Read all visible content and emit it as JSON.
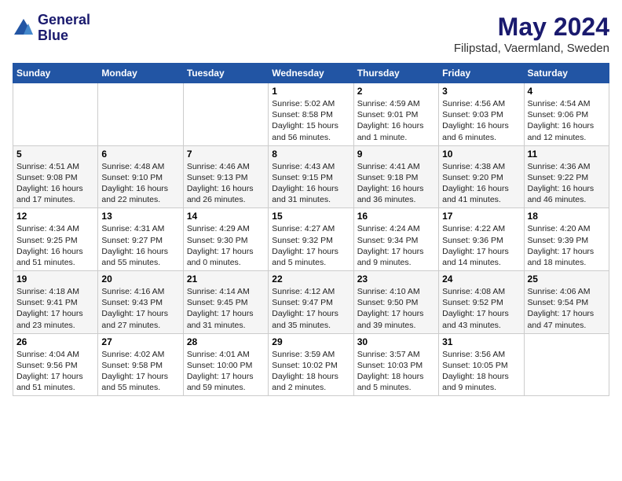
{
  "logo": {
    "line1": "General",
    "line2": "Blue"
  },
  "title": "May 2024",
  "subtitle": "Filipstad, Vaermland, Sweden",
  "days_of_week": [
    "Sunday",
    "Monday",
    "Tuesday",
    "Wednesday",
    "Thursday",
    "Friday",
    "Saturday"
  ],
  "weeks": [
    [
      {
        "day": "",
        "info": ""
      },
      {
        "day": "",
        "info": ""
      },
      {
        "day": "",
        "info": ""
      },
      {
        "day": "1",
        "info": "Sunrise: 5:02 AM\nSunset: 8:58 PM\nDaylight: 15 hours\nand 56 minutes."
      },
      {
        "day": "2",
        "info": "Sunrise: 4:59 AM\nSunset: 9:01 PM\nDaylight: 16 hours\nand 1 minute."
      },
      {
        "day": "3",
        "info": "Sunrise: 4:56 AM\nSunset: 9:03 PM\nDaylight: 16 hours\nand 6 minutes."
      },
      {
        "day": "4",
        "info": "Sunrise: 4:54 AM\nSunset: 9:06 PM\nDaylight: 16 hours\nand 12 minutes."
      }
    ],
    [
      {
        "day": "5",
        "info": "Sunrise: 4:51 AM\nSunset: 9:08 PM\nDaylight: 16 hours\nand 17 minutes."
      },
      {
        "day": "6",
        "info": "Sunrise: 4:48 AM\nSunset: 9:10 PM\nDaylight: 16 hours\nand 22 minutes."
      },
      {
        "day": "7",
        "info": "Sunrise: 4:46 AM\nSunset: 9:13 PM\nDaylight: 16 hours\nand 26 minutes."
      },
      {
        "day": "8",
        "info": "Sunrise: 4:43 AM\nSunset: 9:15 PM\nDaylight: 16 hours\nand 31 minutes."
      },
      {
        "day": "9",
        "info": "Sunrise: 4:41 AM\nSunset: 9:18 PM\nDaylight: 16 hours\nand 36 minutes."
      },
      {
        "day": "10",
        "info": "Sunrise: 4:38 AM\nSunset: 9:20 PM\nDaylight: 16 hours\nand 41 minutes."
      },
      {
        "day": "11",
        "info": "Sunrise: 4:36 AM\nSunset: 9:22 PM\nDaylight: 16 hours\nand 46 minutes."
      }
    ],
    [
      {
        "day": "12",
        "info": "Sunrise: 4:34 AM\nSunset: 9:25 PM\nDaylight: 16 hours\nand 51 minutes."
      },
      {
        "day": "13",
        "info": "Sunrise: 4:31 AM\nSunset: 9:27 PM\nDaylight: 16 hours\nand 55 minutes."
      },
      {
        "day": "14",
        "info": "Sunrise: 4:29 AM\nSunset: 9:30 PM\nDaylight: 17 hours\nand 0 minutes."
      },
      {
        "day": "15",
        "info": "Sunrise: 4:27 AM\nSunset: 9:32 PM\nDaylight: 17 hours\nand 5 minutes."
      },
      {
        "day": "16",
        "info": "Sunrise: 4:24 AM\nSunset: 9:34 PM\nDaylight: 17 hours\nand 9 minutes."
      },
      {
        "day": "17",
        "info": "Sunrise: 4:22 AM\nSunset: 9:36 PM\nDaylight: 17 hours\nand 14 minutes."
      },
      {
        "day": "18",
        "info": "Sunrise: 4:20 AM\nSunset: 9:39 PM\nDaylight: 17 hours\nand 18 minutes."
      }
    ],
    [
      {
        "day": "19",
        "info": "Sunrise: 4:18 AM\nSunset: 9:41 PM\nDaylight: 17 hours\nand 23 minutes."
      },
      {
        "day": "20",
        "info": "Sunrise: 4:16 AM\nSunset: 9:43 PM\nDaylight: 17 hours\nand 27 minutes."
      },
      {
        "day": "21",
        "info": "Sunrise: 4:14 AM\nSunset: 9:45 PM\nDaylight: 17 hours\nand 31 minutes."
      },
      {
        "day": "22",
        "info": "Sunrise: 4:12 AM\nSunset: 9:47 PM\nDaylight: 17 hours\nand 35 minutes."
      },
      {
        "day": "23",
        "info": "Sunrise: 4:10 AM\nSunset: 9:50 PM\nDaylight: 17 hours\nand 39 minutes."
      },
      {
        "day": "24",
        "info": "Sunrise: 4:08 AM\nSunset: 9:52 PM\nDaylight: 17 hours\nand 43 minutes."
      },
      {
        "day": "25",
        "info": "Sunrise: 4:06 AM\nSunset: 9:54 PM\nDaylight: 17 hours\nand 47 minutes."
      }
    ],
    [
      {
        "day": "26",
        "info": "Sunrise: 4:04 AM\nSunset: 9:56 PM\nDaylight: 17 hours\nand 51 minutes."
      },
      {
        "day": "27",
        "info": "Sunrise: 4:02 AM\nSunset: 9:58 PM\nDaylight: 17 hours\nand 55 minutes."
      },
      {
        "day": "28",
        "info": "Sunrise: 4:01 AM\nSunset: 10:00 PM\nDaylight: 17 hours\nand 59 minutes."
      },
      {
        "day": "29",
        "info": "Sunrise: 3:59 AM\nSunset: 10:02 PM\nDaylight: 18 hours\nand 2 minutes."
      },
      {
        "day": "30",
        "info": "Sunrise: 3:57 AM\nSunset: 10:03 PM\nDaylight: 18 hours\nand 5 minutes."
      },
      {
        "day": "31",
        "info": "Sunrise: 3:56 AM\nSunset: 10:05 PM\nDaylight: 18 hours\nand 9 minutes."
      },
      {
        "day": "",
        "info": ""
      }
    ]
  ]
}
